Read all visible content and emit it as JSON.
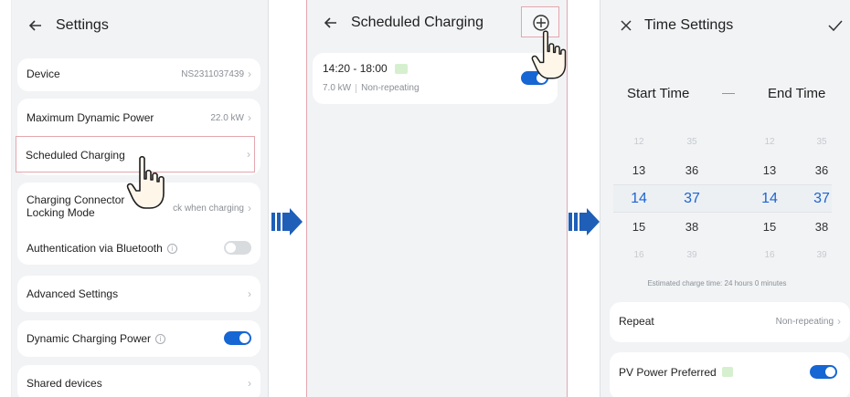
{
  "settings": {
    "title": "Settings",
    "device_label": "Device",
    "device_value": "NS2311037439",
    "max_power_label": "Maximum Dynamic Power",
    "max_power_value": "22.0 kW",
    "scheduled_label": "Scheduled Charging",
    "lock_label_line1": "Charging Connector",
    "lock_label_line2": "Locking Mode",
    "lock_value": "ck when charging",
    "bluetooth_label": "Authentication via Bluetooth",
    "advanced_label": "Advanced Settings",
    "dynamic_label": "Dynamic Charging Power",
    "shared_label": "Shared devices"
  },
  "scheduled": {
    "title": "Scheduled Charging",
    "item_time": "14:20 - 18:00",
    "item_power": "7.0 kW",
    "item_repeat": "Non-repeating"
  },
  "time_settings": {
    "title": "Time Settings",
    "start_label": "Start Time",
    "separator": "—",
    "end_label": "End Time",
    "start_hours": [
      "12",
      "13",
      "14",
      "15",
      "16"
    ],
    "start_minutes": [
      "35",
      "36",
      "37",
      "38",
      "39"
    ],
    "end_hours": [
      "12",
      "13",
      "14",
      "15",
      "16"
    ],
    "end_minutes": [
      "35",
      "36",
      "37",
      "38",
      "39"
    ],
    "estimate": "Estimated charge time: 24 hours 0 minutes",
    "repeat_label": "Repeat",
    "repeat_value": "Non-repeating",
    "pv_label": "PV Power Preferred"
  },
  "colors": {
    "accent": "#1666d4",
    "flow_arrow": "#1f5fb8",
    "highlight_border": "#e3a7ae"
  },
  "icons": {
    "back": "arrow-left-icon",
    "chevron": "chevron-right-icon",
    "add": "plus-circle-icon",
    "close": "close-icon",
    "confirm": "check-icon",
    "info": "info-icon",
    "leaf": "leaf-icon",
    "pointer": "hand-pointer-icon"
  }
}
